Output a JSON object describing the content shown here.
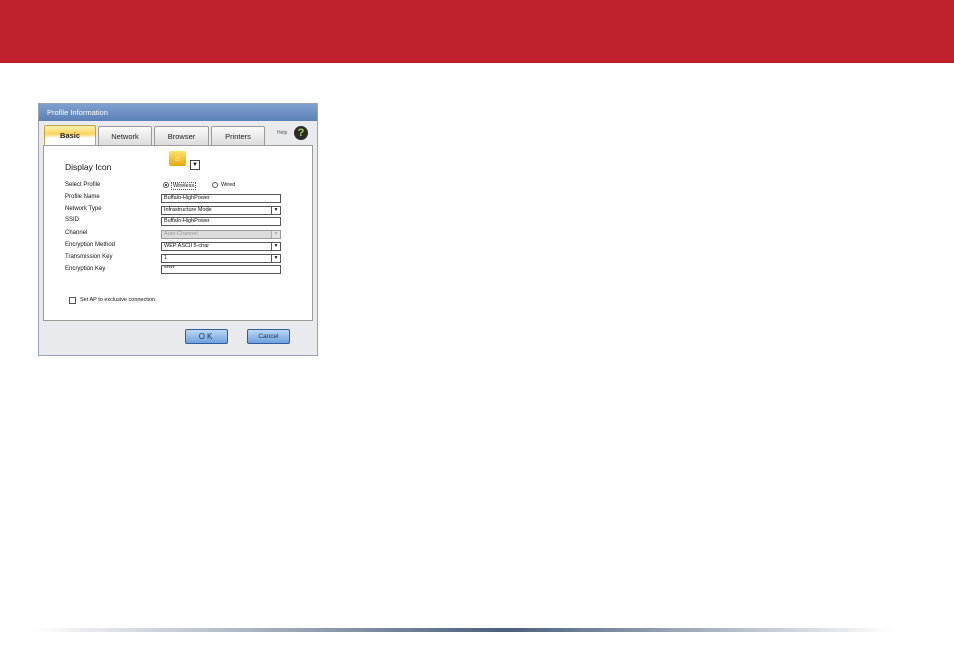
{
  "dialog": {
    "title": "Profile Information",
    "tabs": [
      {
        "label": "Basic",
        "active": true
      },
      {
        "label": "Network",
        "active": false
      },
      {
        "label": "Browser",
        "active": false
      },
      {
        "label": "Printers",
        "active": false
      }
    ],
    "help_label": "Help",
    "help_glyph": "?",
    "display_icon_label": "Display Icon",
    "fields": {
      "select_profile": {
        "label": "Select Profile",
        "options": [
          "Wireless",
          "Wired"
        ],
        "selected": "Wireless"
      },
      "profile_name": {
        "label": "Profile Name",
        "value": "Buffalo-HighPower"
      },
      "network_type": {
        "label": "Network Type",
        "value": "Infrastructure Mode"
      },
      "ssid": {
        "label": "SSID",
        "value": "Buffalo-HighPower"
      },
      "channel": {
        "label": "Channel",
        "value": "Auto-Channel"
      },
      "encryption_method": {
        "label": "Encryption Method",
        "value": "WEP ASCII 5-char"
      },
      "transmission_key": {
        "label": "Transmission Key",
        "value": "1"
      },
      "encryption_key": {
        "label": "Encryption Key",
        "value": "*****"
      }
    },
    "exclusive_checkbox": {
      "label": "Set AP to exclusive connection.",
      "checked": false
    },
    "buttons": {
      "ok": "OK",
      "cancel": "Cancel"
    }
  },
  "colors": {
    "banner": "#c1202d",
    "button": "#6fa0e0",
    "active_tab": "#ffd35a"
  }
}
